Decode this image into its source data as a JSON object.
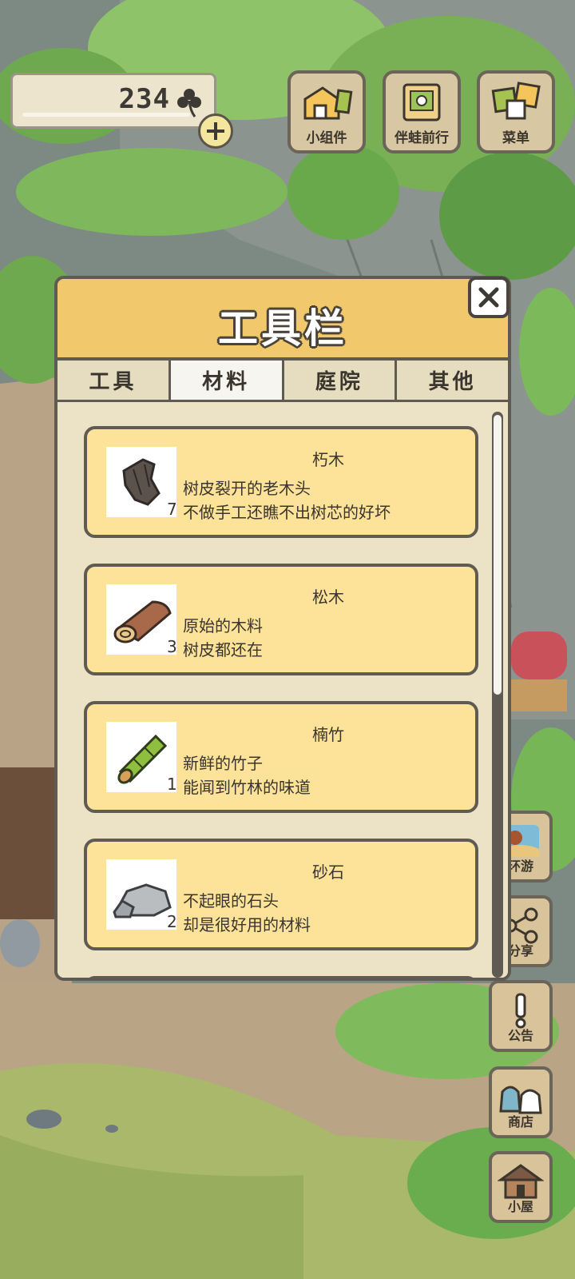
{
  "clover": {
    "count": "234",
    "add_icon": "plus-icon",
    "icon": "clover-icon"
  },
  "top_buttons": [
    {
      "label": "小组件",
      "icon": "widget-icon"
    },
    {
      "label": "伴蛙前行",
      "icon": "companion-icon"
    },
    {
      "label": "菜单",
      "icon": "menu-icon"
    }
  ],
  "side_buttons": [
    {
      "label": "环游",
      "icon": "travel-icon"
    },
    {
      "label": "分享",
      "icon": "share-icon"
    },
    {
      "label": "公告",
      "icon": "notice-icon"
    },
    {
      "label": "商店",
      "icon": "shop-icon"
    },
    {
      "label": "小屋",
      "icon": "house-icon"
    }
  ],
  "panel": {
    "title": "工具栏",
    "tabs": [
      "工具",
      "材料",
      "庭院",
      "其他"
    ],
    "active_tab": "材料",
    "close_icon": "close-icon",
    "items": [
      {
        "name": "朽木",
        "qty": "7",
        "desc1": "树皮裂开的老木头",
        "desc2": "不做手工还瞧不出树芯的好坏",
        "icon": "rotten-wood-icon"
      },
      {
        "name": "松木",
        "qty": "3",
        "desc1": "原始的木料",
        "desc2": "树皮都还在",
        "icon": "pine-log-icon"
      },
      {
        "name": "楠竹",
        "qty": "1",
        "desc1": "新鲜的竹子",
        "desc2": "能闻到竹林的味道",
        "icon": "bamboo-icon"
      },
      {
        "name": "砂石",
        "qty": "2",
        "desc1": "不起眼的石头",
        "desc2": "却是很好用的材料",
        "icon": "stone-icon"
      }
    ]
  },
  "colors": {
    "header": "#f2c86d",
    "item_bg": "#fde29a",
    "panel_bg": "#ebe3c9",
    "border": "#5f5b52"
  }
}
